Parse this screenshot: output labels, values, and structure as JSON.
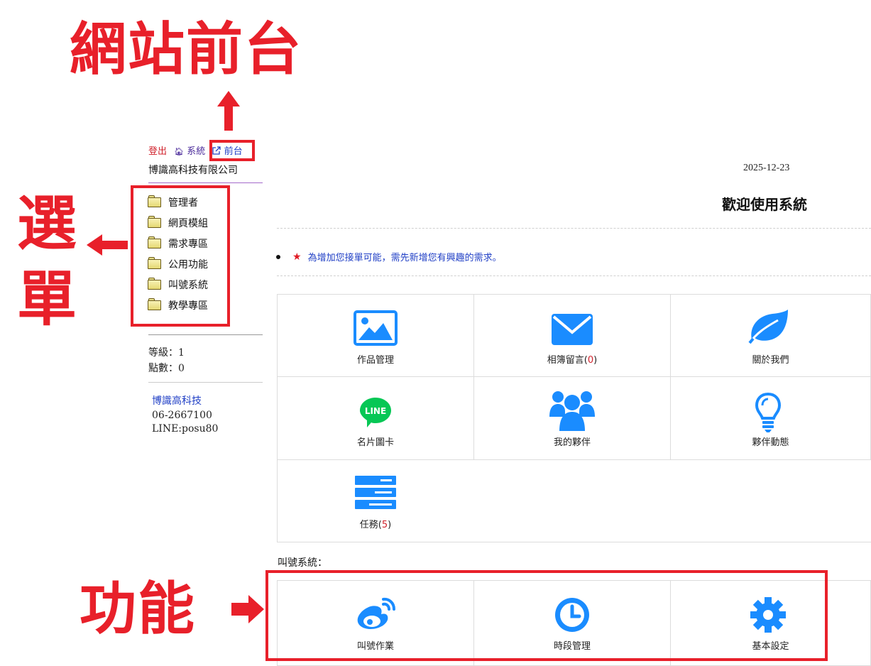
{
  "annotations": {
    "front": "網站前台",
    "menu_line1": "選",
    "menu_line2": "單",
    "function": "功能"
  },
  "header": {
    "logout": "登出",
    "system": "系統",
    "front": "前台",
    "company": "博識高科技有限公司",
    "date": "2025-12-23",
    "welcome": "歡迎使用系統"
  },
  "sidebar": {
    "menu": [
      {
        "label": "管理者"
      },
      {
        "label": "網頁模組"
      },
      {
        "label": "需求專區"
      },
      {
        "label": "公用功能"
      },
      {
        "label": "叫號系統"
      },
      {
        "label": "教學專區"
      }
    ],
    "level": "等級：1",
    "points": "點數：0",
    "contact": {
      "name": "博識高科技",
      "phone": "06-2667100",
      "line": "LINE:posu80"
    }
  },
  "notice": "為增加您接單可能，需先新增您有興趣的需求。",
  "tiles": [
    {
      "label": "作品管理",
      "icon": "image-icon"
    },
    {
      "label": "相簿留言",
      "count": "0",
      "icon": "envelope-icon"
    },
    {
      "label": "關於我們",
      "icon": "leaf-icon"
    },
    {
      "label": "名片圖卡",
      "icon": "line-icon"
    },
    {
      "label": "我的夥伴",
      "icon": "users-icon"
    },
    {
      "label": "夥伴動態",
      "icon": "lightbulb-icon"
    },
    {
      "label": "任務",
      "count": "5",
      "icon": "tasks-icon"
    }
  ],
  "call_system": {
    "title": "叫號系統：",
    "tiles": [
      {
        "label": "叫號作業",
        "icon": "weibo-icon"
      },
      {
        "label": "時段管理",
        "icon": "clock-icon"
      },
      {
        "label": "基本設定",
        "icon": "gear-icon"
      }
    ]
  },
  "colors": {
    "icon_blue": "#1a8cff",
    "annotation_red": "#e8202a",
    "line_green": "#06c755"
  }
}
